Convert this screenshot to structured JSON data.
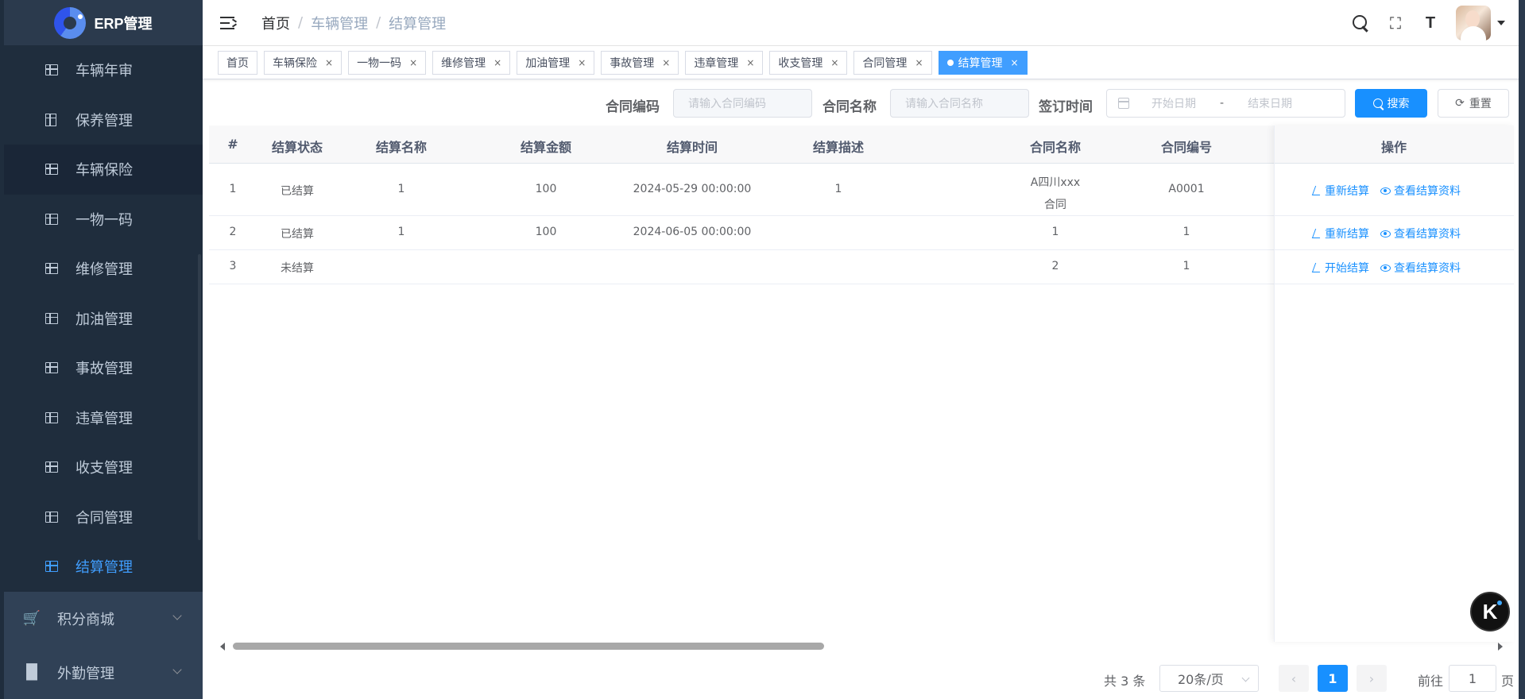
{
  "app": {
    "logo_text": "ERP管理"
  },
  "sidebar": {
    "items": [
      {
        "label": "车辆年审"
      },
      {
        "label": "保养管理"
      },
      {
        "label": "车辆保险"
      },
      {
        "label": "一物一码"
      },
      {
        "label": "维修管理"
      },
      {
        "label": "加油管理"
      },
      {
        "label": "事故管理"
      },
      {
        "label": "违章管理"
      },
      {
        "label": "收支管理"
      },
      {
        "label": "合同管理"
      },
      {
        "label": "结算管理"
      }
    ],
    "groups": [
      {
        "label": "积分商城"
      },
      {
        "label": "外勤管理"
      }
    ]
  },
  "breadcrumb": {
    "home": "首页",
    "level1": "车辆管理",
    "level2": "结算管理",
    "separator": "/"
  },
  "tags": [
    {
      "label": "首页"
    },
    {
      "label": "车辆保险"
    },
    {
      "label": "一物一码"
    },
    {
      "label": "维修管理"
    },
    {
      "label": "加油管理"
    },
    {
      "label": "事故管理"
    },
    {
      "label": "违章管理"
    },
    {
      "label": "收支管理"
    },
    {
      "label": "合同管理"
    },
    {
      "label": "结算管理"
    }
  ],
  "tag_close": "×",
  "filter": {
    "contract_code_label": "合同编码",
    "contract_code_placeholder": "请输入合同编码",
    "contract_name_label": "合同名称",
    "contract_name_placeholder": "请输入合同名称",
    "sign_time_label": "签订时间",
    "start_date": "开始日期",
    "date_sep": "-",
    "end_date": "结束日期",
    "search_btn": "搜索",
    "reset_btn": "重置"
  },
  "table": {
    "columns": [
      "#",
      "结算状态",
      "结算名称",
      "结算金额",
      "结算时间",
      "结算描述",
      "合同名称",
      "合同编号",
      "操作"
    ],
    "rows": [
      {
        "idx": "1",
        "status": "已结算",
        "name": "1",
        "amount": "100",
        "time": "2024-05-29 00:00:00",
        "desc": "1",
        "contract_name_l1": "A四川xxx",
        "contract_name_l2": "合同",
        "contract_no": "A0001",
        "op1": "重新结算",
        "op2": "查看结算资料"
      },
      {
        "idx": "2",
        "status": "已结算",
        "name": "1",
        "amount": "100",
        "time": "2024-06-05 00:00:00",
        "desc": "",
        "contract_name_l1": "1",
        "contract_name_l2": "",
        "contract_no": "1",
        "op1": "重新结算",
        "op2": "查看结算资料"
      },
      {
        "idx": "3",
        "status": "未结算",
        "name": "",
        "amount": "",
        "time": "",
        "desc": "",
        "contract_name_l1": "2",
        "contract_name_l2": "",
        "contract_no": "1",
        "op1": "开始结算",
        "op2": "查看结算资料"
      }
    ]
  },
  "pagination": {
    "total": "共 3 条",
    "page_size": "20条/页",
    "current": "1",
    "goto_label": "前往",
    "goto_value": "1",
    "page_unit": "页",
    "prev": "‹",
    "next": "›"
  },
  "badge": {
    "text": "K"
  },
  "colors": {
    "primary": "#1890ff",
    "sidebar_bg": "#304156",
    "sidebar_active": "#409eff"
  }
}
